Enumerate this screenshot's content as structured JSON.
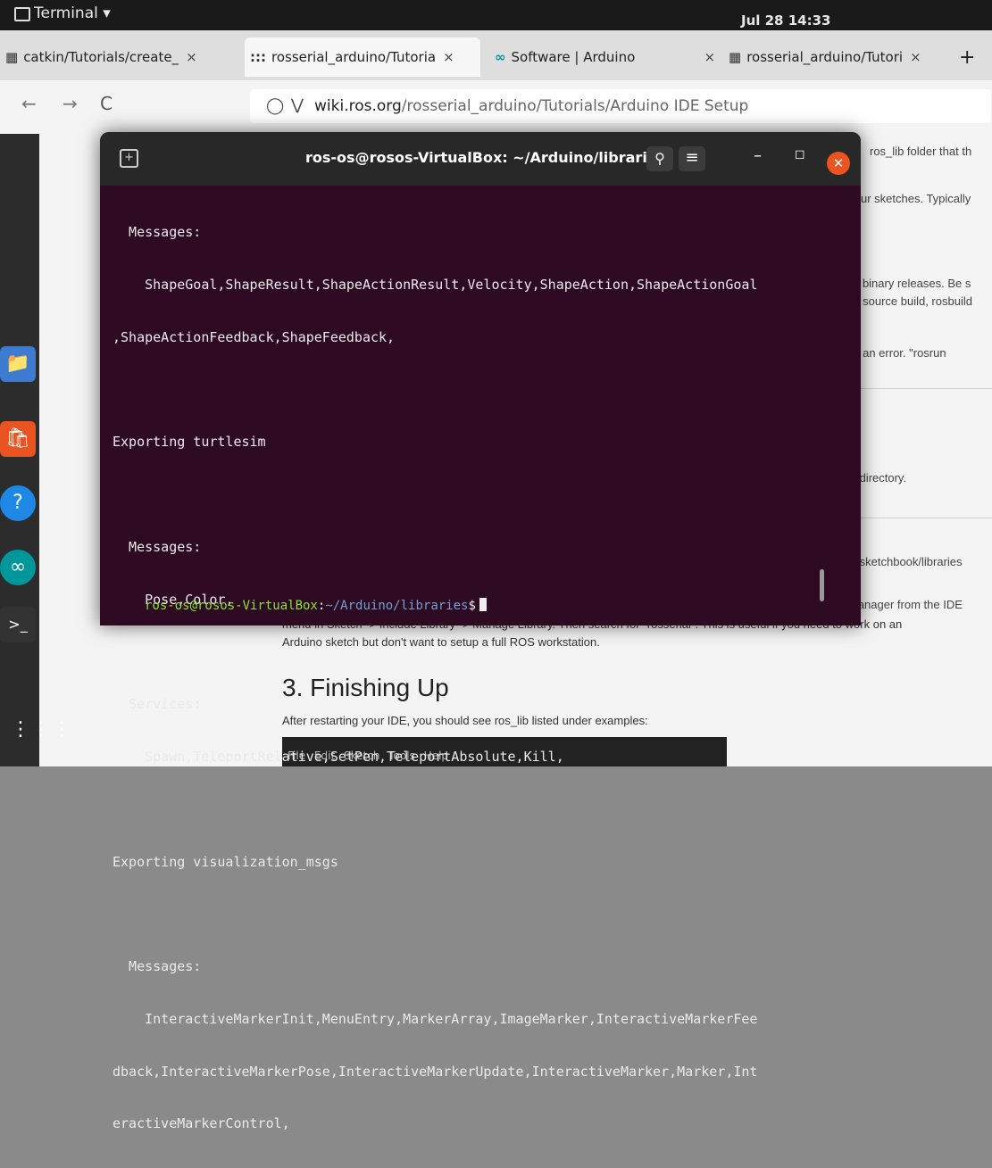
{
  "topbar": {
    "app_label": "Terminal ▾",
    "clock": "Jul 28 14:33"
  },
  "tabs": [
    {
      "icon": "▦",
      "label": "catkin/Tutorials/create_",
      "close": "×",
      "active": false
    },
    {
      "icon": ":::",
      "label": "rosserial_arduino/Tutoria",
      "close": "×",
      "active": true
    },
    {
      "icon": "∞",
      "label": "Software | Arduino",
      "close": "×",
      "active": false
    },
    {
      "icon": "▦",
      "label": "rosserial_arduino/Tutori",
      "close": "×",
      "active": false
    }
  ],
  "new_tab": "+",
  "nav": {
    "back": "←",
    "forward": "→",
    "reload": "C"
  },
  "url": {
    "host": "wiki.ros.org",
    "path": "/rosserial_arduino/Tutorials/Arduino IDE Setup"
  },
  "page": {
    "fragments": [
      "ros_lib folder that th",
      "ur sketches. Typically",
      "r binary releases. Be s",
      "y source build, rosbuild",
      "s an error. \"rosrun",
      "ient directory.",
      "em's sketchbook/libraries",
      "rary Manager from the IDE"
    ],
    "body_lines": [
      "menu in Sketch -> Include Library -> Manage Library. Then search for \"rosserial\". This is useful if you need to work on an",
      "Arduino sketch but don't want to setup a full ROS workstation."
    ],
    "heading": "3. Finishing Up",
    "after_heading": "After restarting your IDE, you should see ros_lib listed under examples:",
    "ide_menu": [
      "File",
      "Edit",
      "Sketch",
      "Tools",
      "Help"
    ]
  },
  "terminal": {
    "title": "ros-os@rosos-VirtualBox: ~/Arduino/libraries",
    "lines": [
      "  Messages:",
      "    ShapeGoal,ShapeResult,ShapeActionResult,Velocity,ShapeAction,ShapeActionGoal",
      ",ShapeActionFeedback,ShapeFeedback,",
      "",
      "Exporting turtlesim",
      "",
      "  Messages:",
      "    Pose,Color,",
      "",
      "  Services:",
      "    Spawn,TeleportRelative,SetPen,TeleportAbsolute,Kill,",
      "",
      "Exporting visualization_msgs",
      "",
      "  Messages:",
      "    InteractiveMarkerInit,MenuEntry,MarkerArray,ImageMarker,InteractiveMarkerFee",
      "dback,InteractiveMarkerPose,InteractiveMarkerUpdate,InteractiveMarker,Marker,Int",
      "eractiveMarkerControl,"
    ],
    "prompt": {
      "user_host": "ros-os@rosos-VirtualBox",
      "colon": ":",
      "path": "~/Arduino/libraries",
      "dollar": "$"
    }
  },
  "dock": [
    {
      "icon": "files-icon",
      "color": "#3d7bd1"
    },
    {
      "icon": "software-store-icon",
      "color": "#e95420"
    },
    {
      "icon": "help-icon",
      "color": "#1e88e5"
    },
    {
      "icon": "arduino-icon",
      "color": "#00979c"
    },
    {
      "icon": "terminal-icon",
      "color": "#333333"
    }
  ],
  "dock_apps_grid": "⋮⋮⋮"
}
